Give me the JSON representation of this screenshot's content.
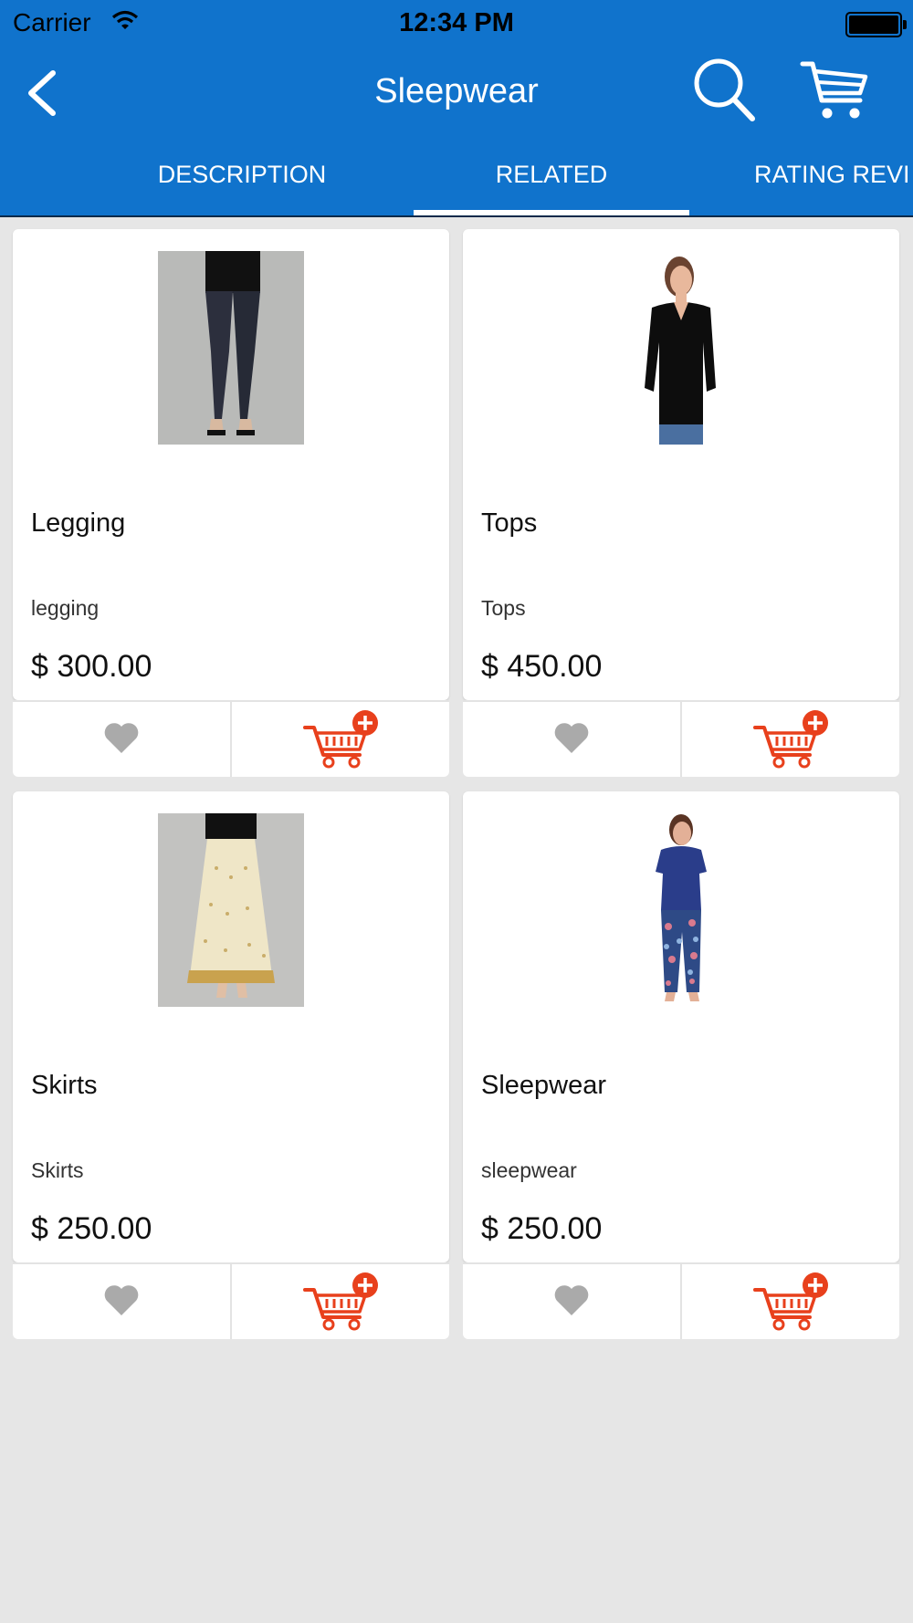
{
  "status_bar": {
    "carrier": "Carrier",
    "time": "12:34 PM"
  },
  "nav": {
    "title": "Sleepwear",
    "back_icon": "chevron-left-icon",
    "search_icon": "search-icon",
    "cart_icon": "shopping-cart-icon"
  },
  "tabs": [
    {
      "label": "DESCRIPTION",
      "active": false
    },
    {
      "label": "RELATED",
      "active": true
    },
    {
      "label": "RATING REVI",
      "active": false
    }
  ],
  "colors": {
    "header": "#1073cc",
    "accent_cart": "#e8401c",
    "heart": "#aaaaaa",
    "background": "#e6e6e6"
  },
  "products": [
    {
      "name": "Legging",
      "description": "legging",
      "price": "$ 300.00",
      "image": "legging-photo"
    },
    {
      "name": "Tops",
      "description": "Tops",
      "price": "$ 450.00",
      "image": "tops-photo"
    },
    {
      "name": "Skirts",
      "description": "Skirts",
      "price": "$ 250.00",
      "image": "skirt-photo"
    },
    {
      "name": "Sleepwear",
      "description": "sleepwear",
      "price": "$ 250.00",
      "image": "sleepwear-photo"
    }
  ]
}
